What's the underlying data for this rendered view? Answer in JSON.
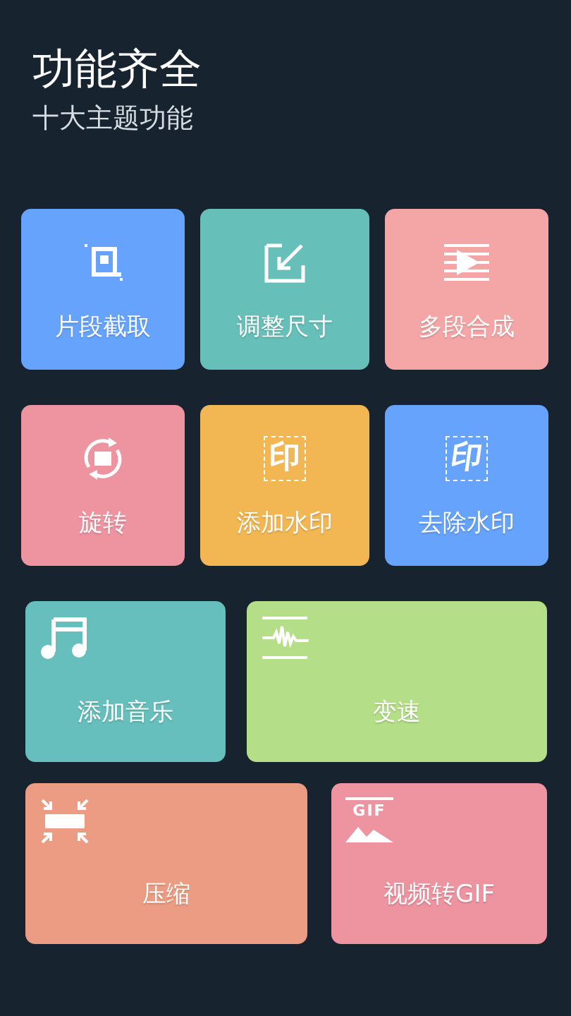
{
  "header": {
    "title": "功能齐全",
    "subtitle": "十大主题功能"
  },
  "rows": [
    {
      "kind": "square",
      "cards": [
        {
          "kind": "crop",
          "label": "片段截取",
          "color": "#66a3fd"
        },
        {
          "kind": "resize",
          "label": "调整尺寸",
          "color": "#67bfb9"
        },
        {
          "kind": "merge",
          "label": "多段合成",
          "color": "#f4a6a6"
        }
      ]
    },
    {
      "kind": "square",
      "cards": [
        {
          "kind": "rotate",
          "label": "旋转",
          "color": "#ee93a0"
        },
        {
          "kind": "watermark-add",
          "label": "添加水印",
          "icon_text": "印",
          "color": "#f2b752"
        },
        {
          "kind": "watermark-remove",
          "label": "去除水印",
          "icon_text": "印",
          "color": "#66a3fd"
        }
      ]
    },
    {
      "kind": "wide",
      "cards": [
        {
          "kind": "music",
          "label": "添加音乐",
          "color": "#66bfbc"
        },
        {
          "kind": "speed",
          "label": "变速",
          "color": "#b4df88"
        }
      ]
    },
    {
      "kind": "wide",
      "cards": [
        {
          "kind": "compress",
          "label": "压缩",
          "color": "#eb9c82"
        },
        {
          "kind": "gif",
          "label": "视频转GIF",
          "icon_text": "GIF",
          "color": "#ee93a0"
        }
      ]
    }
  ]
}
